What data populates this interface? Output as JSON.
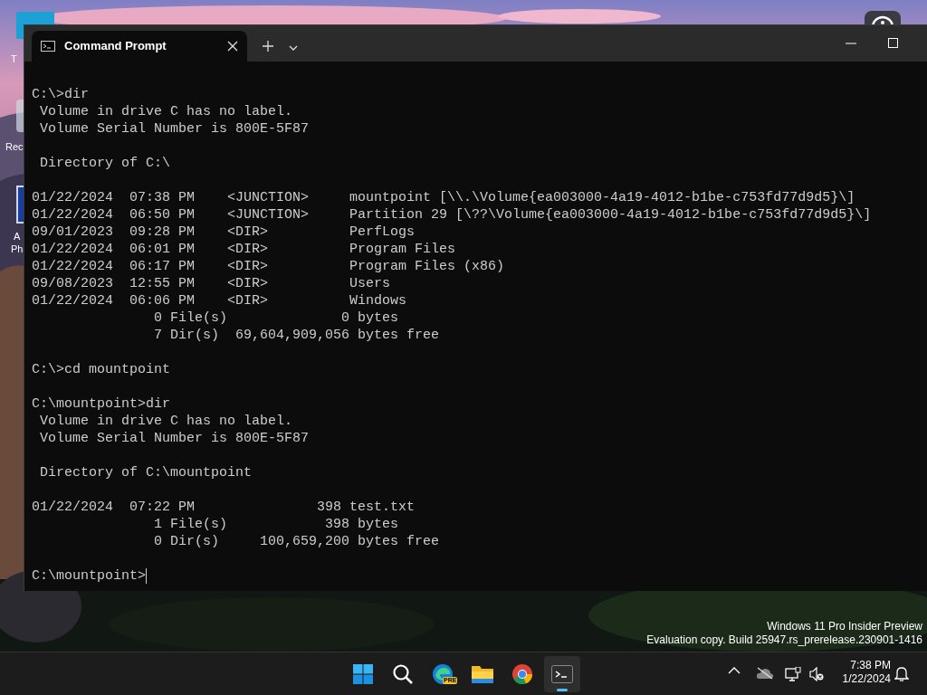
{
  "desktop": {
    "icons": [
      {
        "kind": "blue",
        "lines": [
          "T"
        ]
      },
      {
        "kind": "recycle",
        "lines": [
          "Rec"
        ]
      },
      {
        "kind": "shortcut",
        "lines": [
          "A",
          "Ph"
        ]
      }
    ]
  },
  "window": {
    "tabs": [
      {
        "title": "Command Prompt",
        "selected": true
      }
    ],
    "terminal": {
      "blocks": [
        [
          "C:\\>dir",
          " Volume in drive C has no label.",
          " Volume Serial Number is 800E-5F87"
        ],
        [
          " Directory of C:\\"
        ],
        [
          "01/22/2024  07:38 PM    <JUNCTION>     mountpoint [\\\\.\\Volume{ea003000-4a19-4012-b1be-c753fd77d9d5}\\]",
          "01/22/2024  06:50 PM    <JUNCTION>     Partition 29 [\\??\\Volume{ea003000-4a19-4012-b1be-c753fd77d9d5}\\]",
          "09/01/2023  09:28 PM    <DIR>          PerfLogs",
          "01/22/2024  06:01 PM    <DIR>          Program Files",
          "01/22/2024  06:17 PM    <DIR>          Program Files (x86)",
          "09/08/2023  12:55 PM    <DIR>          Users",
          "01/22/2024  06:06 PM    <DIR>          Windows",
          "               0 File(s)              0 bytes",
          "               7 Dir(s)  69,604,909,056 bytes free"
        ],
        [
          "C:\\>cd mountpoint"
        ],
        [
          "C:\\mountpoint>dir",
          " Volume in drive C has no label.",
          " Volume Serial Number is 800E-5F87"
        ],
        [
          " Directory of C:\\mountpoint"
        ],
        [
          "01/22/2024  07:22 PM               398 test.txt",
          "               1 File(s)            398 bytes",
          "               0 Dir(s)     100,659,200 bytes free"
        ],
        [
          "C:\\mountpoint>"
        ]
      ],
      "cursor": true
    }
  },
  "watermark": [
    "Windows 11 Pro Insider Preview",
    "Evaluation copy. Build 25947.rs_prerelease.230901-1416"
  ],
  "taskbar": {
    "apps": [
      {
        "kind": "start",
        "selected": false
      },
      {
        "kind": "search",
        "selected": false
      },
      {
        "kind": "edge",
        "badge": "PRE",
        "selected": false
      },
      {
        "kind": "explorer",
        "selected": false
      },
      {
        "kind": "chrome",
        "selected": false
      },
      {
        "kind": "terminal",
        "selected": true
      }
    ],
    "tray": {
      "time": "7:38 PM",
      "date": "1/22/2024"
    }
  }
}
